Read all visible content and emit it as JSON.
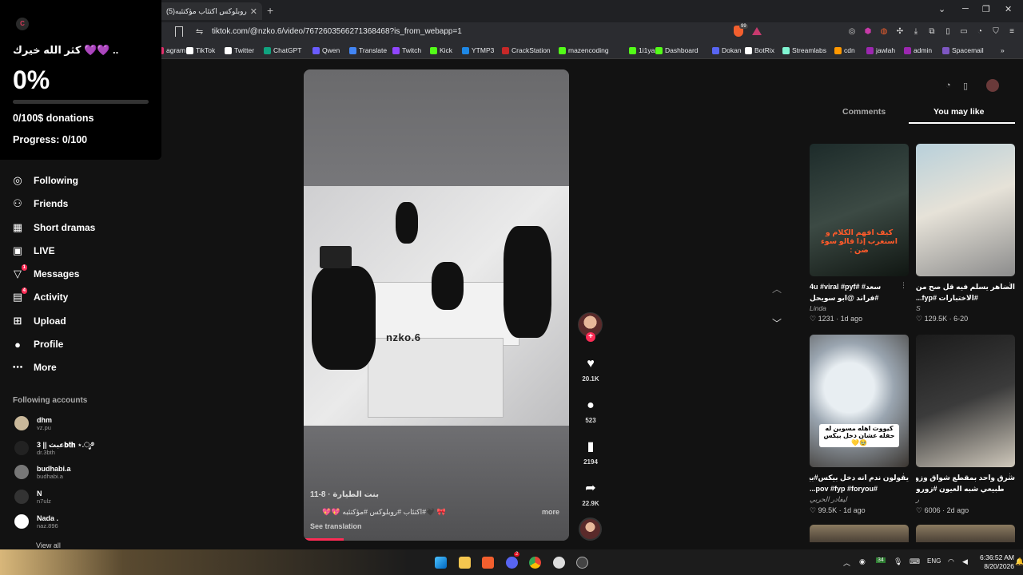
{
  "browser": {
    "tab_title": "روبلوكس اكتئاب مؤكتئبه(5)",
    "url": "tiktok.com/@nzko.6/video/7672603566271368468?is_from_webapp=1",
    "shield_count": "99",
    "bookmarks": [
      {
        "label": "agram",
        "color": "#e1306c"
      },
      {
        "label": "TikTok",
        "color": "#ffffff"
      },
      {
        "label": "Twitter",
        "color": "#ffffff"
      },
      {
        "label": "ChatGPT",
        "color": "#10a37f"
      },
      {
        "label": "Qwen",
        "color": "#6a5cff"
      },
      {
        "label": "Translate",
        "color": "#4285f4"
      },
      {
        "label": "Twitch",
        "color": "#9146ff"
      },
      {
        "label": "Kick",
        "color": "#53fc18"
      },
      {
        "label": "YTMP3",
        "color": "#1e88e5"
      },
      {
        "label": "CrackStation",
        "color": "#c62828"
      },
      {
        "label": "mazencoding",
        "color": "#53fc18"
      },
      {
        "label": "1i1yas",
        "color": "#53fc18"
      },
      {
        "label": "Dashboard",
        "color": "#53fc18"
      },
      {
        "label": "Dokan",
        "color": "#5865f2"
      },
      {
        "label": "BotRix",
        "color": "#ffffff"
      },
      {
        "label": "Streamlabs",
        "color": "#80f5d2"
      },
      {
        "label": "cdn",
        "color": "#ff9800"
      },
      {
        "label": "jawlah",
        "color": "#9c27b0"
      },
      {
        "label": "admin",
        "color": "#9c27b0"
      },
      {
        "label": "Spacemail",
        "color": "#7e57c2"
      }
    ]
  },
  "donation": {
    "logo_letter": "C",
    "message": "كثر الله خيرك 💜💜 ..",
    "percent": "0%",
    "progress_fraction": 0,
    "count_text": "0/100$ donations",
    "progress_text": "Progress: 0/100"
  },
  "sidebar": {
    "items": [
      {
        "label": "Following",
        "icon": "following-icon"
      },
      {
        "label": "Friends",
        "icon": "friends-icon"
      },
      {
        "label": "Short dramas",
        "icon": "short-dramas-icon"
      },
      {
        "label": "LIVE",
        "icon": "live-icon"
      },
      {
        "label": "Messages",
        "icon": "messages-icon",
        "badge": "1"
      },
      {
        "label": "Activity",
        "icon": "activity-icon",
        "badge": "4"
      },
      {
        "label": "Upload",
        "icon": "upload-icon"
      },
      {
        "label": "Profile",
        "icon": "profile-icon"
      },
      {
        "label": "More",
        "icon": "more-icon"
      }
    ],
    "following_header": "Following accounts",
    "accounts": [
      {
        "name": "dhm",
        "handle": "vz.pu",
        "color": "#c9b89a"
      },
      {
        "name": "3 || عبث𝐛𝐭𝐡 ⋆.ೃ࿔",
        "handle": "dr.3bth",
        "color": "#222222"
      },
      {
        "name": "budhabi.a",
        "handle": "budhabi.a",
        "color": "#777777"
      },
      {
        "name": "N",
        "handle": "n7ulz",
        "color": "#333333"
      },
      {
        "name": "Nada .",
        "handle": "naz.896",
        "color": "#ffffff"
      }
    ],
    "view_all": "View all"
  },
  "video": {
    "overlay_name": "nzko.6",
    "author_line": "بنت الطيارة · 8-11",
    "caption": "🎀 🖤#اكتئاب #روبلوكس #مؤكتئبه 💖💖",
    "more": "more",
    "see_translation": "See translation",
    "progress_fraction": 0.15
  },
  "actions": {
    "likes": "20.1K",
    "comments": "523",
    "saves": "2194",
    "shares": "22.9K"
  },
  "panel": {
    "tab_comments": "Comments",
    "tab_you_may_like": "You may like",
    "cards": [
      {
        "thumb_text": "كيف افهم الكلام و استغرب إذا قالو سوء ضن :",
        "thumb_text_color": "#ff5a2a",
        "title_line1": "سعد# #4u #viral #pyf",
        "title_line2": "#فراند @ابو سويحل",
        "author": "Linda",
        "likes": "1231",
        "age": "1d ago"
      },
      {
        "thumb_text": "",
        "thumb_text_color": "#ffffff",
        "title_line1": "الضاهر يسلم فيه قل صح من",
        "title_line2": "#الاختبارات #fyp...",
        "author": "S",
        "likes": "129.5K",
        "age": "6-20"
      },
      {
        "thumb_text": "كيووت اهله مسوين له حفله عشان دخل بيكس🥹💛",
        "thumb_text_color": "#000000",
        "title_line1": "يقولون ندم انه دخل بيكس#بيكس",
        "title_line2": "#pov #fyp #foryou...",
        "author": "ليفادر الحربي",
        "likes": "99.5K",
        "age": "1d ago"
      },
      {
        "thumb_text": "",
        "thumb_text_color": "#ffffff",
        "title_line1": "شرق واحد بمقطع شواق وزور مو",
        "title_line2": "طبيعي شبه العيون #زورو",
        "author": "ر",
        "likes": "6006",
        "age": "2d ago"
      }
    ]
  },
  "taskbar": {
    "lang": "ENG",
    "time": "6:36:52 AM",
    "date": "8/20/2026",
    "discord_badge": "2",
    "tray_badge": "34"
  }
}
